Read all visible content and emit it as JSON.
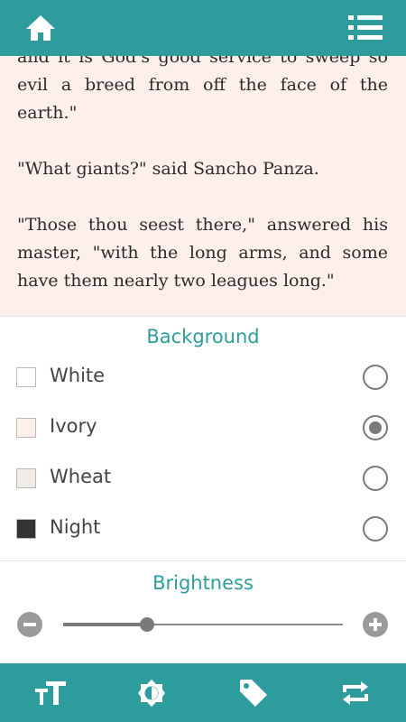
{
  "colors": {
    "accent": "#2e9c9c",
    "reader_background": "#fdf0eb"
  },
  "header": {
    "home_icon": "home-icon",
    "menu_icon": "list-menu-icon"
  },
  "reader": {
    "paragraphs": [
      "and it is God's good service to sweep so evil a breed from off the face of the earth.\"",
      "\"What giants?\" said Sancho Panza.",
      "\"Those thou seest there,\" answered his master, \"with the long arms, and some have them nearly two leagues long.\""
    ]
  },
  "background": {
    "title": "Background",
    "options": [
      {
        "label": "White",
        "swatch": "#ffffff",
        "selected": false
      },
      {
        "label": "Ivory",
        "swatch": "#fdf0eb",
        "selected": true
      },
      {
        "label": "Wheat",
        "swatch": "#f0ebe6",
        "selected": false
      },
      {
        "label": "Night",
        "swatch": "#333333",
        "selected": false
      }
    ]
  },
  "brightness": {
    "title": "Brightness",
    "level": 0.3
  },
  "bottom_bar": {
    "items": [
      {
        "name": "font-size-icon"
      },
      {
        "name": "brightness-icon"
      },
      {
        "name": "tag-icon"
      },
      {
        "name": "repeat-icon"
      }
    ]
  }
}
